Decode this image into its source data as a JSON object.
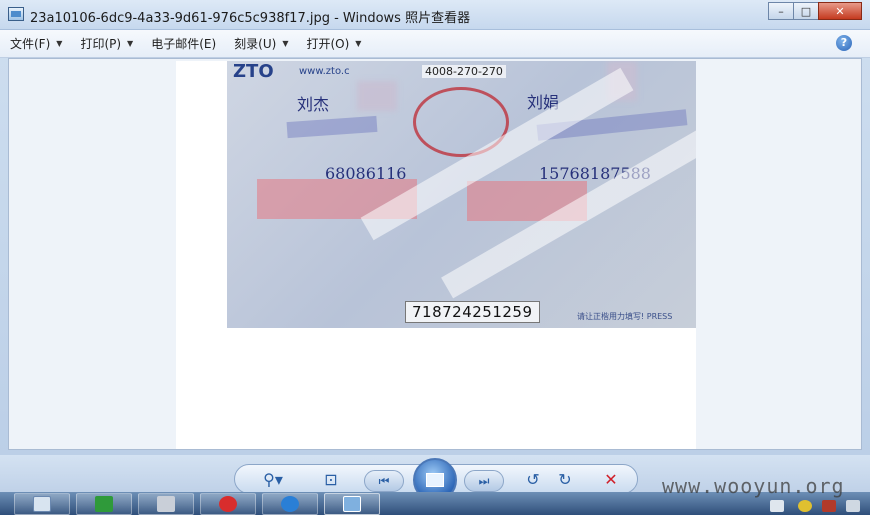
{
  "window": {
    "title": "23a10106-6dc9-4a33-9d61-976c5c938f17.jpg - Windows 照片查看器",
    "buttons": {
      "minimize": "–",
      "maximize": "□",
      "close": "✕"
    }
  },
  "menubar": {
    "items": [
      {
        "label": "文件(F)",
        "caret": "▼"
      },
      {
        "label": "打印(P)",
        "caret": "▼"
      },
      {
        "label": "电子邮件(E)",
        "caret": ""
      },
      {
        "label": "刻录(U)",
        "caret": "▼"
      },
      {
        "label": "打开(O)",
        "caret": "▼"
      }
    ],
    "help": "?"
  },
  "photo": {
    "logo": "ZTO",
    "url": "www.zto.c",
    "hotline": "4008-270-270",
    "handwriting": [
      "刘杰",
      "刘娟",
      "68086116",
      "15768187588"
    ],
    "tracking_number": "718724251259",
    "footer_text": "请让正楷用力填写! PRESS"
  },
  "toolbar": {
    "zoom": "⚲▾",
    "fit": "⊡",
    "prev": "⏮",
    "next": "⏭",
    "rotate_ccw": "↺",
    "rotate_cw": "↻",
    "delete": "✕"
  },
  "watermark": "www.wooyun.org",
  "colors": {
    "accent": "#2a5fa5",
    "close": "#c43a1f",
    "delete": "#d0202a"
  }
}
